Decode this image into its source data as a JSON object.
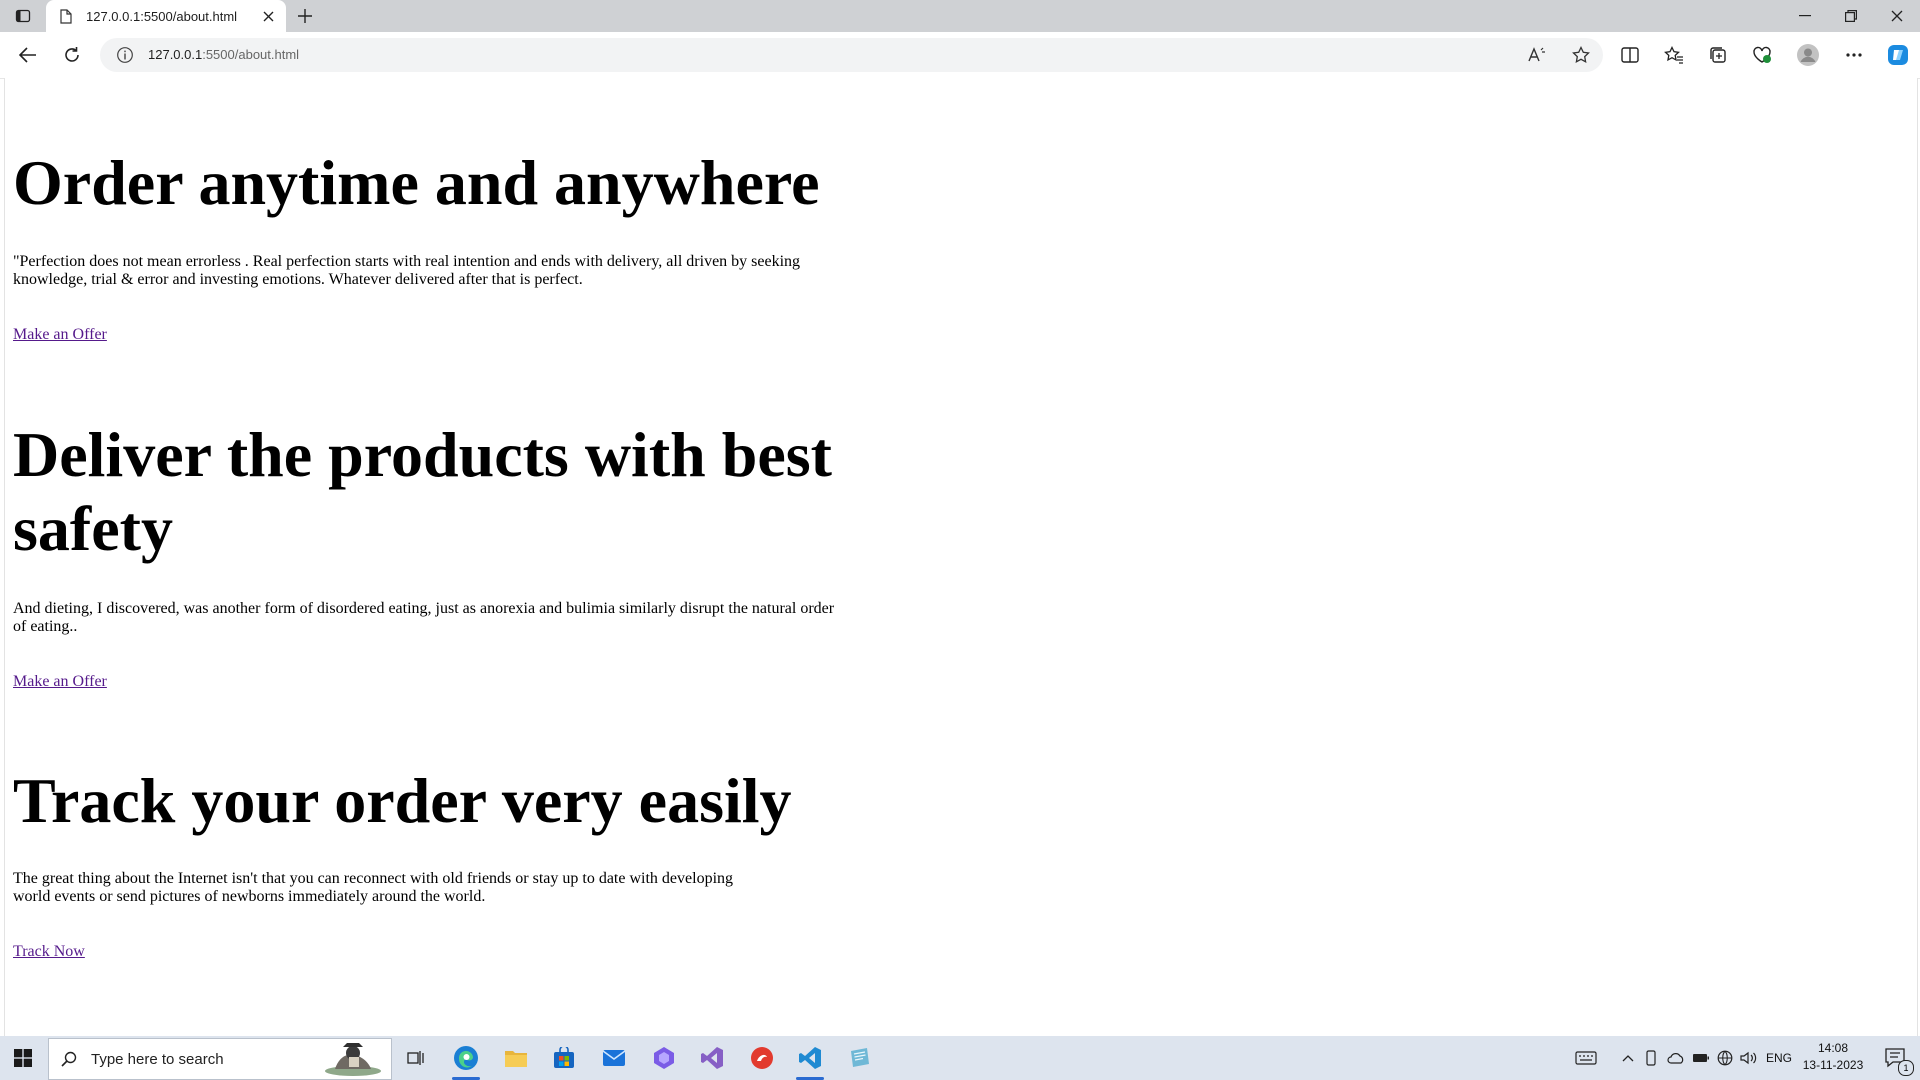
{
  "browser": {
    "tab_title": "127.0.0.1:5500/about.html",
    "url_host": "127.0.0.1",
    "url_path": ":5500/about.html"
  },
  "page": {
    "sections": [
      {
        "heading": "Order anytime and anywhere",
        "text": "\"Perfection does not mean errorless . Real perfection starts with real intention and ends with delivery, all driven by seeking knowledge, trial & error and investing emotions. Whatever delivered after that is perfect.",
        "link": "Make an Offer"
      },
      {
        "heading": "Deliver the products with best safety",
        "text": "And dieting, I discovered, was another form of disordered eating, just as anorexia and bulimia similarly disrupt the natural order of eating..",
        "link": "Make an Offer"
      },
      {
        "heading": "Track your order very easily",
        "text": "The great thing about the Internet isn't that you can reconnect with old friends or stay up to date with developing world events or send pictures of newborns immediately around the world.",
        "link": "Track Now"
      }
    ]
  },
  "taskbar": {
    "search_placeholder": "Type here to search",
    "language": "ENG",
    "time": "14:08",
    "date": "13-11-2023",
    "notification_count": "1"
  },
  "colors": {
    "visited_link": "#551a8b",
    "taskbar_bg": "#dde4ee",
    "titlebar_bg": "#cfd1d4",
    "accent": "#2a6bd1"
  }
}
